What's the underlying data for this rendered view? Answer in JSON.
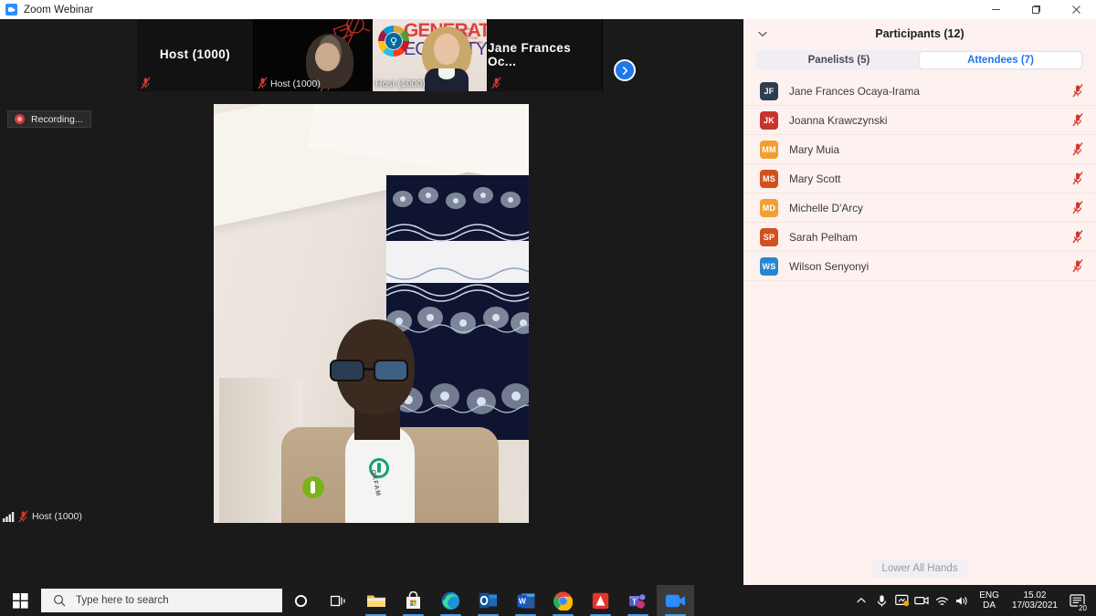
{
  "window": {
    "title": "Zoom Webinar",
    "icon": "zoom-icon",
    "minimize_label": "Minimize",
    "restore_label": "Restore",
    "close_label": "Close"
  },
  "stage": {
    "recording": {
      "label": "Recording...",
      "icon": "record-icon"
    },
    "self_status": {
      "name": "Host (1000)",
      "signal_icon": "signal-bars-icon",
      "mic_icon": "mic-off-icon"
    },
    "next_button": {
      "icon": "chevron-right-icon",
      "label": "Next page"
    },
    "filmstrip": [
      {
        "name": "Host (1000)",
        "muted": true,
        "has_video": false,
        "label_position": "center"
      },
      {
        "name": "Host (1000)",
        "muted": true,
        "has_video": true,
        "label_position": "bottom"
      },
      {
        "name": "Host (1000)",
        "muted": false,
        "has_video": true,
        "label_position": "bottom"
      },
      {
        "name": "Jane Frances Oc...",
        "muted": true,
        "has_video": false,
        "label_position": "center"
      }
    ],
    "main_speaker": {
      "description": "active speaker video"
    }
  },
  "panel": {
    "title": "Participants (12)",
    "collapse_icon": "chevron-down-icon",
    "tabs": [
      {
        "label": "Panelists (5)",
        "active": false
      },
      {
        "label": "Attendees (7)",
        "active": true
      }
    ],
    "participants": [
      {
        "initials": "JF",
        "name": "Jane Frances Ocaya-Irama",
        "color": "#2d3e50",
        "muted": true
      },
      {
        "initials": "JK",
        "name": "Joanna Krawczynski",
        "color": "#c8342b",
        "muted": true
      },
      {
        "initials": "MM",
        "name": "Mary Muia",
        "color": "#f0a030",
        "muted": true
      },
      {
        "initials": "MS",
        "name": "Mary Scott",
        "color": "#d4501e",
        "muted": true
      },
      {
        "initials": "MD",
        "name": "Michelle D'Arcy",
        "color": "#f0a030",
        "muted": true
      },
      {
        "initials": "SP",
        "name": "Sarah Pelham",
        "color": "#d4501e",
        "muted": true
      },
      {
        "initials": "WS",
        "name": "Wilson Senyonyi",
        "color": "#2a85d0",
        "muted": true
      }
    ],
    "footer_button": "Lower All Hands"
  },
  "taskbar": {
    "start_label": "Start",
    "search_placeholder": "Type here to search",
    "search_icon": "search-icon",
    "cortana_icon": "cortana-circle-icon",
    "taskview_icon": "task-view-icon",
    "apps": [
      {
        "name": "file-explorer",
        "running": true
      },
      {
        "name": "microsoft-store",
        "running": true
      },
      {
        "name": "microsoft-edge",
        "running": true
      },
      {
        "name": "outlook",
        "running": true
      },
      {
        "name": "word",
        "running": true
      },
      {
        "name": "chrome",
        "running": true
      },
      {
        "name": "adobe-acrobat",
        "running": true
      },
      {
        "name": "microsoft-teams",
        "running": true
      },
      {
        "name": "zoom",
        "running": true,
        "active": true
      }
    ],
    "tray": {
      "show_hidden_icon": "chevron-up-icon",
      "icons": [
        "microphone-icon",
        "screen-share-icon",
        "camera-icon",
        "wifi-icon",
        "volume-icon"
      ],
      "language_line1": "ENG",
      "language_line2": "DA",
      "time": "15.02",
      "date": "17/03/2021",
      "notifications_count": "20",
      "notifications_icon": "action-center-icon"
    }
  },
  "colors": {
    "zoom_blue": "#2d8cff",
    "tab_active_text": "#2176e8",
    "panel_bg": "#fdf2ef",
    "stage_bg": "#1a1a1a",
    "taskbar_bg": "#1b1b1b",
    "mic_off_red": "#d0392f"
  }
}
